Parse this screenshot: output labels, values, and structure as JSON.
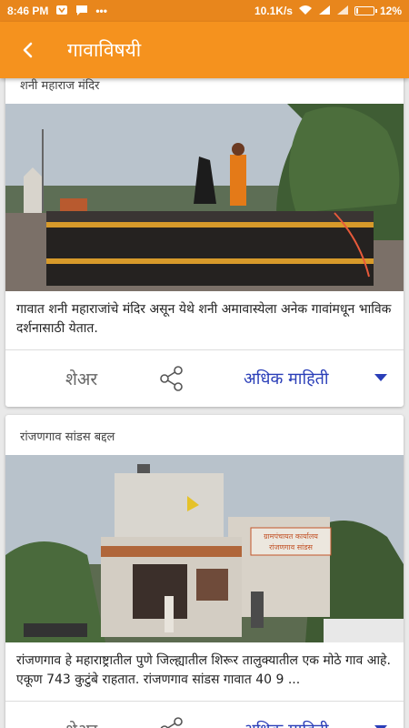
{
  "status": {
    "time": "8:46 PM",
    "speed": "10.1K/s",
    "battery": "12%",
    "battery_level": 0.12
  },
  "appbar": {
    "title": "गावाविषयी"
  },
  "cards": [
    {
      "title": "शनी महाराज मंदिर",
      "description": "गावात शनी महाराजांचे मंदिर असून येथे शनी अमावास्येला अनेक गावांमधून भाविक दर्शनासाठी येतात.",
      "share_label": "शेअर",
      "more_label": "अधिक माहिती"
    },
    {
      "title": "रांजणगाव सांडस बद्दल",
      "description": "रांजणगाव हे महाराष्ट्रातील पुणे जिल्ह्यातील शिरूर तालुक्यातील एक मोठे गाव आहे. एकूण 743 कुटुंबे राहतात. रांजणगाव सांडस गावात 40 9 ...",
      "sign_text_1": "ग्रामपंचायत कार्यालय",
      "sign_text_2": "रांजणगाव सांडस",
      "share_label": "शेअर",
      "more_label": "अधिक माहिती"
    }
  ],
  "colors": {
    "statusbar": "#e8861c",
    "appbar": "#f5921e",
    "link": "#2a3eb8"
  }
}
